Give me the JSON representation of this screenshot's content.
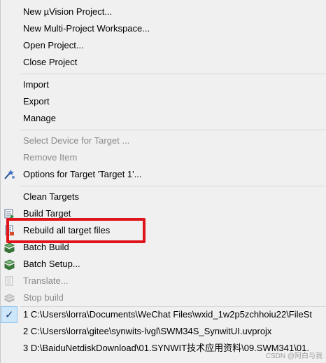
{
  "menu": {
    "items": [
      {
        "label": "New µVision Project..."
      },
      {
        "label": "New Multi-Project Workspace..."
      },
      {
        "label": "Open Project..."
      },
      {
        "label": "Close Project"
      },
      {
        "label": "Import"
      },
      {
        "label": "Export"
      },
      {
        "label": "Manage"
      },
      {
        "label": "Select Device for Target ..."
      },
      {
        "label": "Remove Item"
      },
      {
        "label": "Options for Target 'Target 1'..."
      },
      {
        "label": "Clean Targets"
      },
      {
        "label": "Build Target"
      },
      {
        "label": "Rebuild all target files"
      },
      {
        "label": "Batch Build"
      },
      {
        "label": "Batch Setup..."
      },
      {
        "label": "Translate..."
      },
      {
        "label": "Stop build"
      },
      {
        "label": "1 C:\\Users\\lorra\\Documents\\WeChat Files\\wxid_1w2p5zchhoiu22\\FileSt"
      },
      {
        "label": "2 C:\\Users\\lorra\\gitee\\synwits-lvgl\\SWM34S_SynwitUI.uvprojx"
      },
      {
        "label": "3 D:\\BaiduNetdiskDownload\\01.SYNWIT技术应用资料\\09.SWM341\\01."
      }
    ]
  },
  "watermark": "CSDN @阿白与我",
  "colors": {
    "highlight": "#e0151b",
    "disabled_text": "#8a8a8a",
    "menu_bg": "#f0f0f0"
  }
}
